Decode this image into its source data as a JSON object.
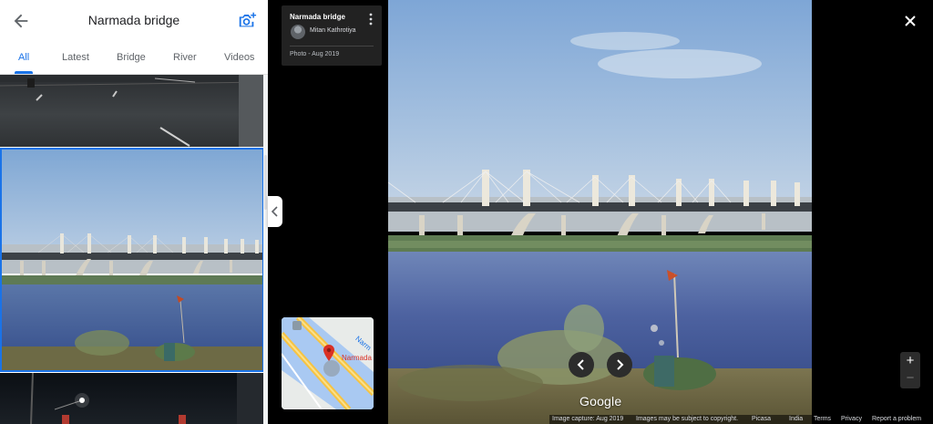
{
  "header": {
    "title": "Narmada bridge",
    "back_icon": "arrow-back-icon",
    "add_photo_icon": "add-photo-icon"
  },
  "tabs": [
    {
      "label": "All",
      "active": true
    },
    {
      "label": "Latest"
    },
    {
      "label": "Bridge"
    },
    {
      "label": "River"
    },
    {
      "label": "Videos"
    }
  ],
  "info_card": {
    "place": "Narmada bridge",
    "author": "Mitan Kathrotiya",
    "meta": "Photo - Aug 2019"
  },
  "minimap": {
    "label": "Narmada",
    "road_label": "Narm"
  },
  "watermark": "Google",
  "footer": {
    "capture": "Image capture: Aug 2019",
    "copyright": "Images may be subject to copyright.",
    "picasa": "Picasa",
    "country": "India",
    "terms": "Terms",
    "privacy": "Privacy",
    "report": "Report a problem"
  },
  "controls": {
    "zoom_in": "+",
    "zoom_out": "−"
  },
  "colors": {
    "accent": "#1a73e8",
    "pin": "#d93025"
  }
}
